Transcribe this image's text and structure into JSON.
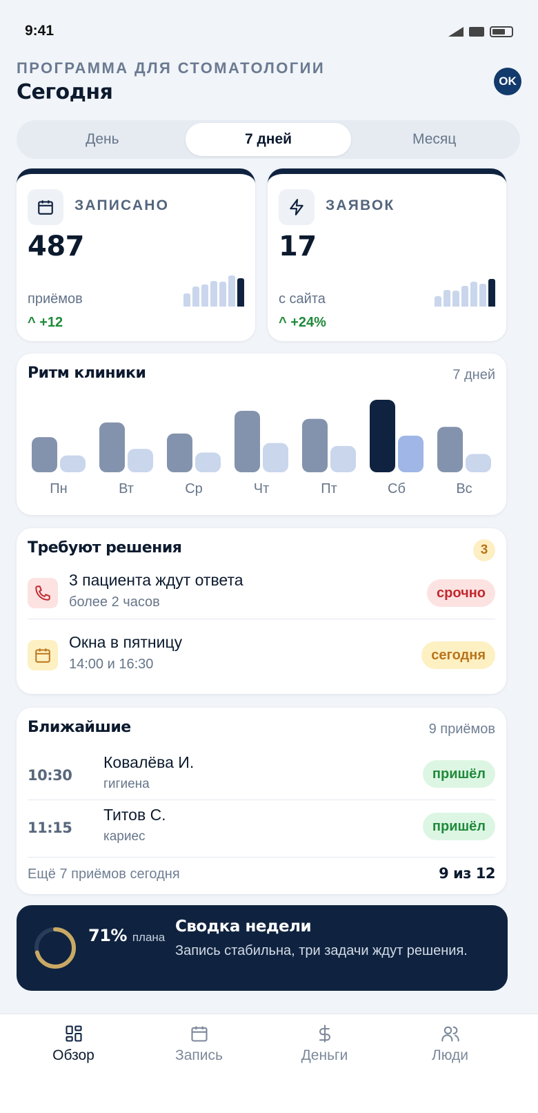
{
  "status": {
    "time": "9:41"
  },
  "header": {
    "eyebrow": "ПРОГРАММА ДЛЯ СТОМАТОЛОГИИ",
    "title": "Сегодня",
    "avatar": "OK"
  },
  "segments": [
    {
      "label": "День"
    },
    {
      "label": "7 дней",
      "active": true
    },
    {
      "label": "Месяц"
    }
  ],
  "stats": [
    {
      "label": "ЗАПИСАНО",
      "value": "487",
      "sub": "приёмов",
      "delta": "+12",
      "icon": "calendar-icon",
      "spark": [
        0.42,
        0.62,
        0.7,
        0.8,
        0.78,
        0.98,
        0.9
      ]
    },
    {
      "label": "ЗАЯВОК",
      "value": "17",
      "sub": "с сайта",
      "delta": "+24%",
      "icon": "lightning-icon",
      "spark": [
        0.32,
        0.52,
        0.5,
        0.66,
        0.78,
        0.72,
        0.88
      ]
    }
  ],
  "rhythm": {
    "title": "Ритм клиники",
    "range": "7 дней",
    "chart_data": {
      "type": "bar",
      "categories": [
        "Пн",
        "Вт",
        "Ср",
        "Чт",
        "Пт",
        "Сб",
        "Вс"
      ],
      "series": [
        {
          "values": [
            48,
            68,
            53,
            84,
            73,
            99,
            62
          ]
        },
        {
          "values": [
            23,
            32,
            27,
            40,
            36,
            50,
            25
          ]
        }
      ],
      "ylim": [
        0,
        100
      ],
      "highlight_index": 5,
      "colors": {
        "primary": "#8393ad",
        "secondary": "#c9d6ec",
        "highlight_primary": "#0f2340",
        "highlight_secondary": "#9fb6e6"
      }
    }
  },
  "decisions": {
    "title": "Требуют решения",
    "count": "3",
    "items": [
      {
        "title": "3 пациента ждут ответа",
        "subtitle": "более 2 часов",
        "badge": "срочно",
        "icon": "phone-icon"
      },
      {
        "title": "Окна в пятницу",
        "subtitle": "14:00 и 16:30",
        "badge": "сегодня",
        "icon": "calendar-icon"
      }
    ]
  },
  "upcoming": {
    "title": "Ближайшие",
    "count_label": "9 приёмов",
    "items": [
      {
        "time": "10:30",
        "name": "Ковалёва И.",
        "procedure": "гигиена",
        "status": "пришёл"
      },
      {
        "time": "11:15",
        "name": "Титов С.",
        "procedure": "кариес",
        "status": "пришёл"
      }
    ],
    "footer_left": "Ещё 7 приёмов сегодня",
    "footer_right": "9 из 12"
  },
  "summary": {
    "percent": "71%",
    "percent_label": "плана",
    "progress": 0.71,
    "title": "Сводка недели",
    "text": "Запись стабильна, три задачи ждут решения."
  },
  "tabs": [
    {
      "label": "Обзор",
      "icon": "dashboard-icon",
      "active": true
    },
    {
      "label": "Запись",
      "icon": "calendar-icon"
    },
    {
      "label": "Деньги",
      "icon": "dollar-icon"
    },
    {
      "label": "Люди",
      "icon": "people-icon"
    }
  ],
  "colors": {
    "accent": "#0f2340",
    "success": "#1f8a3a",
    "urgent_bg": "#fde2e2",
    "urgent_fg": "#c0282d",
    "today_bg": "#fdf0c2",
    "today_fg": "#b9741b",
    "ring": "#c9a964"
  }
}
